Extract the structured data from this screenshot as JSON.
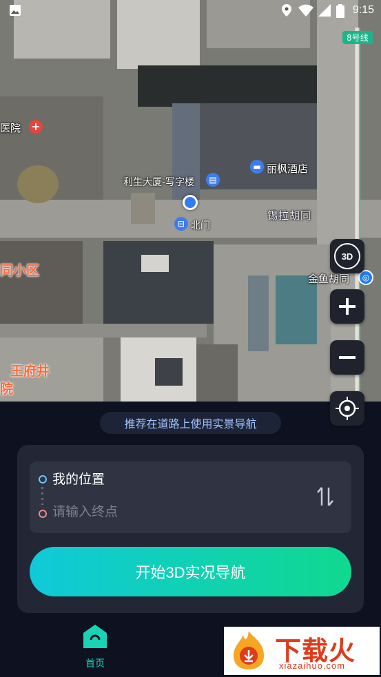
{
  "status_bar": {
    "time": "9:15"
  },
  "map": {
    "metro_badge": "8号线",
    "labels": {
      "hospital": "医院",
      "lisheng_building": "利生大厦-写字楼",
      "north_gate": "北门",
      "lifeng_hotel": "丽枫酒店",
      "xila_hutong": "锡拉胡同",
      "community": "同小区",
      "jinyu_hutong": "金鱼胡同",
      "wangfujing": "王府井",
      "yuan": "院"
    },
    "controls": {
      "view_3d": "3D"
    }
  },
  "hint": "推荐在道路上使用实景导航",
  "route": {
    "origin": "我的位置",
    "destination_placeholder": "请输入终点"
  },
  "start_button": "开始3D实况导航",
  "tabs": [
    {
      "label": "首页"
    }
  ],
  "watermark": {
    "title": "下载火",
    "url": "xiazaihuo.com"
  }
}
